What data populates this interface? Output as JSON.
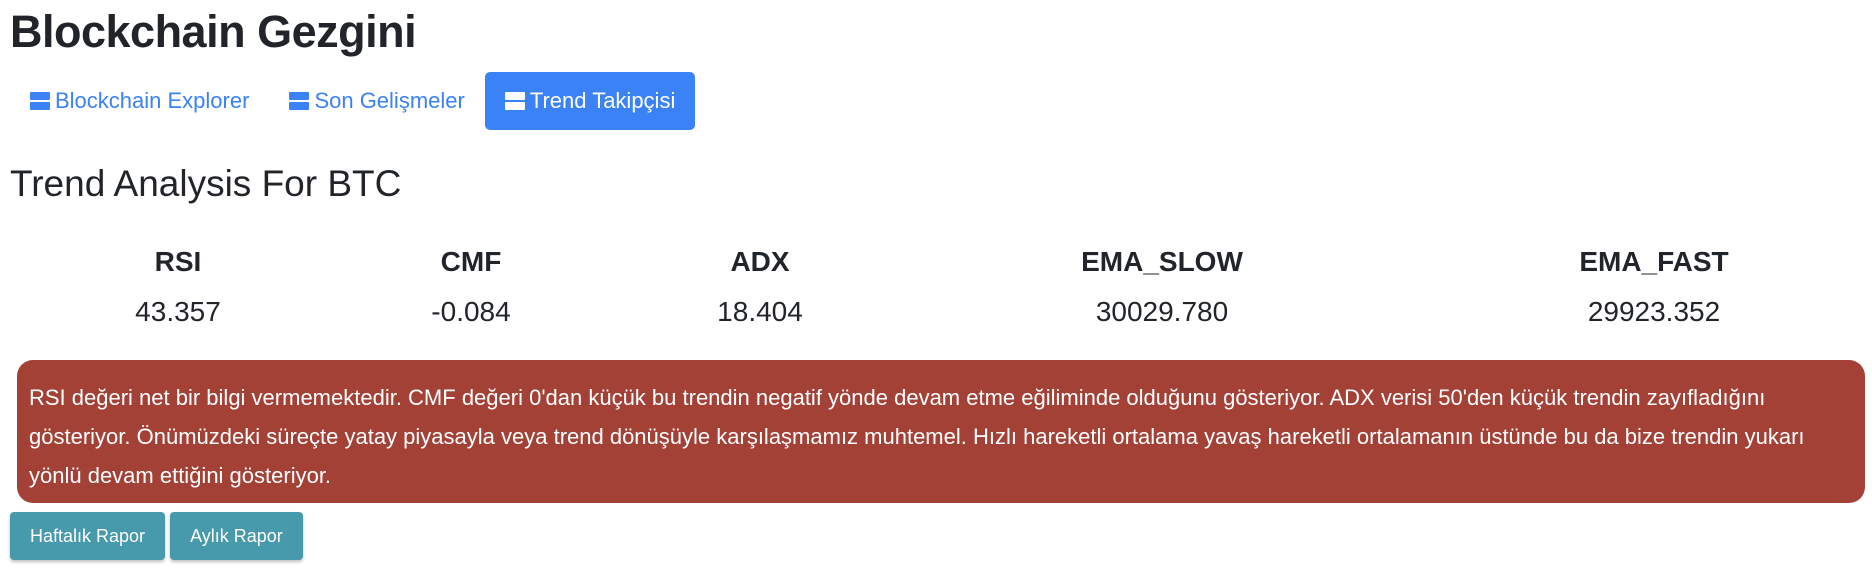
{
  "app": {
    "title": "Blockchain Gezgini"
  },
  "tabs": [
    {
      "label": "Blockchain Explorer",
      "icon": "server-icon",
      "active": false
    },
    {
      "label": "Son Gelişmeler",
      "icon": "server-icon",
      "active": false
    },
    {
      "label": "Trend Takipçisi",
      "icon": "server-icon",
      "active": true
    }
  ],
  "analysis": {
    "title": "Trend Analysis For BTC",
    "metrics": [
      {
        "label": "RSI",
        "value": "43.357"
      },
      {
        "label": "CMF",
        "value": "-0.084"
      },
      {
        "label": "ADX",
        "value": "18.404"
      },
      {
        "label": "EMA_SLOW",
        "value": "30029.780"
      },
      {
        "label": "EMA_FAST",
        "value": "29923.352"
      }
    ],
    "summary": "RSI değeri net bir bilgi vermemektedir. CMF değeri 0'dan küçük bu trendin negatif yönde devam etme eğiliminde olduğunu gösteriyor. ADX verisi 50'den küçük trendin zayıfladığını gösteriyor. Önümüzdeki süreçte yatay piyasayla veya trend dönüşüyle karşılaşmamız muhtemel. Hızlı hareketli ortalama yavaş hareketli ortalamanın üstünde bu da bize trendin yukarı yönlü devam ettiğini gösteriyor."
  },
  "buttons": {
    "weekly_label": "Haftalık Rapor",
    "monthly_label": "Aylık Rapor"
  },
  "colors": {
    "primary": "#3b82f6",
    "alert_bg": "#a44137",
    "button_bg": "#4799ac"
  }
}
